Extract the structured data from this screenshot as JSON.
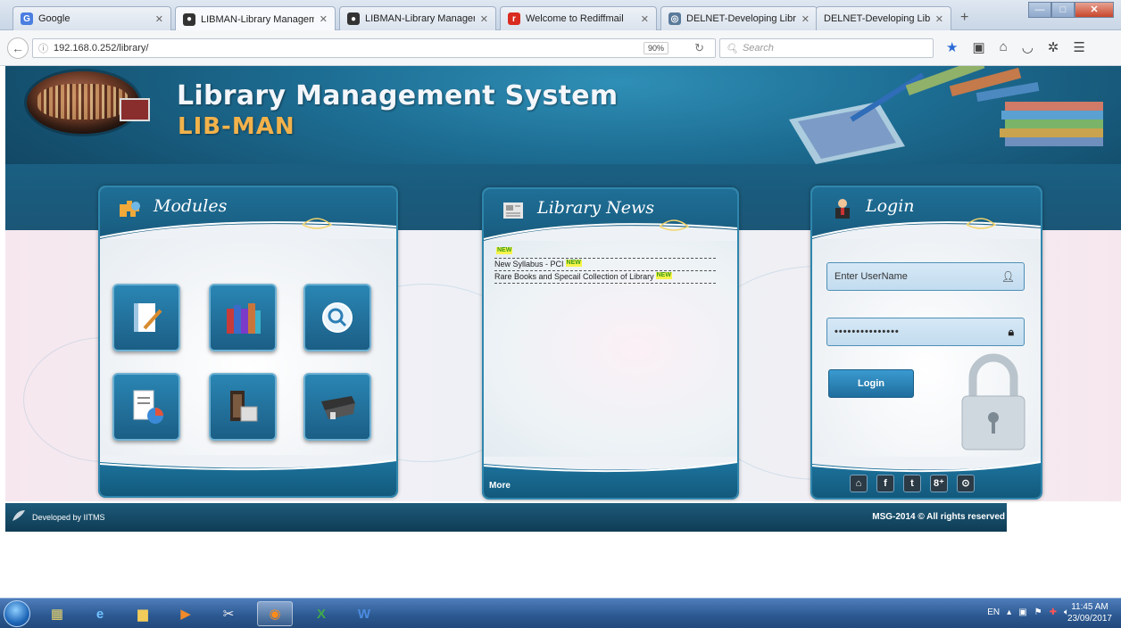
{
  "browser": {
    "tabs": [
      {
        "label": "Google",
        "favicon": "G",
        "favicon_color": "#4a7ee0"
      },
      {
        "label": "LIBMAN-Library Managem",
        "favicon": "●",
        "favicon_color": "#333333"
      },
      {
        "label": "LIBMAN-Library Managem",
        "favicon": "●",
        "favicon_color": "#333333"
      },
      {
        "label": "Welcome to Rediffmail",
        "favicon": "r",
        "favicon_color": "#d92b1f"
      },
      {
        "label": "DELNET-Developing Libra",
        "favicon": "◎",
        "favicon_color": "#5a7a9a"
      },
      {
        "label": "DELNET-Developing Library N",
        "favicon": "",
        "favicon_color": "#dddddd"
      }
    ],
    "url": "192.168.0.252/library/",
    "zoom": "90%",
    "search_placeholder": "Search"
  },
  "header": {
    "title": "Library Management System",
    "subtitle": "LIB-MAN"
  },
  "modules": {
    "title": "Modules",
    "buttons": [
      {
        "icon": "notebook-pen-icon"
      },
      {
        "icon": "books-icon"
      },
      {
        "icon": "magnifier-icon"
      },
      {
        "icon": "report-chart-icon"
      },
      {
        "icon": "book-scanner-icon"
      },
      {
        "icon": "barcode-scanner-icon"
      }
    ]
  },
  "news": {
    "title": "Library News",
    "badge": "NEW",
    "items": [
      {
        "text": ""
      },
      {
        "text": "New Syllabus - PCI"
      },
      {
        "text": "Rare Books and Specail Collection of Library"
      }
    ],
    "more": "More"
  },
  "login": {
    "title": "Login",
    "username_placeholder": "Enter UserName",
    "password_value": "•••••••••••••••",
    "button": "Login",
    "social": [
      "⌂",
      "f",
      "t",
      "8⁺",
      "⊙"
    ]
  },
  "footer": {
    "left": "Developed by IITMS",
    "right": "MSG-2014 © All rights reserved"
  },
  "taskbar": {
    "lang": "EN",
    "time": "11:45 AM",
    "date": "23/09/2017"
  },
  "colors": {
    "header_blue": "#1d6d93",
    "accent_orange": "#f2b24b",
    "panel_border": "#2f86ad"
  }
}
